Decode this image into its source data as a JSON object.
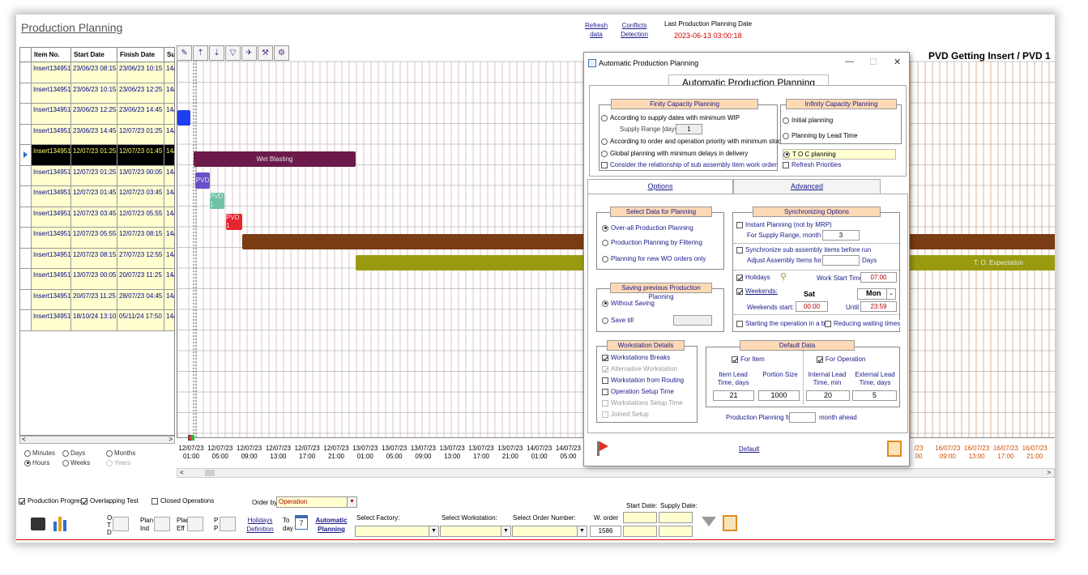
{
  "header": {
    "title": "Production Planning",
    "refresh_line1": "Refresh",
    "refresh_line2": "data",
    "conflicts_line1": "Conflicts",
    "conflicts_line2": "Detection",
    "last_planning_label": "Last Production Planning Date",
    "last_planning_value": "2023-06-13 03:00:18"
  },
  "grid": {
    "headers": [
      "Item No.",
      "Start Date",
      "Finish Date",
      "Su"
    ],
    "rows": [
      {
        "item": "Insert134951",
        "start": "23/06/23 08:15",
        "finish": "23/06/23 10:15",
        "su": "14/"
      },
      {
        "item": "Insert134951",
        "start": "23/06/23 10:15",
        "finish": "23/06/23 12:25",
        "su": "14/"
      },
      {
        "item": "Insert134951",
        "start": "23/06/23 12:25",
        "finish": "23/06/23 14:45",
        "su": "14/"
      },
      {
        "item": "Insert134951",
        "start": "23/06/23 14:45",
        "finish": "12/07/23 01:25",
        "su": "14/"
      },
      {
        "item": "Insert134951",
        "start": "12/07/23 01:25",
        "finish": "12/07/23 01:45",
        "su": "14/"
      },
      {
        "item": "Insert134951",
        "start": "12/07/23 01:25",
        "finish": "13/07/23 00:05",
        "su": "14/"
      },
      {
        "item": "Insert134951",
        "start": "12/07/23 01:45",
        "finish": "12/07/23 03:45",
        "su": "14/"
      },
      {
        "item": "Insert134951",
        "start": "12/07/23 03:45",
        "finish": "12/07/23 05:55",
        "su": "14/"
      },
      {
        "item": "Insert134951",
        "start": "12/07/23 05:55",
        "finish": "12/07/23 08:15",
        "su": "14/"
      },
      {
        "item": "Insert134951",
        "start": "12/07/23 08:15",
        "finish": "27/07/23 12:55",
        "su": "14/"
      },
      {
        "item": "Insert134951",
        "start": "13/07/23 00:05",
        "finish": "20/07/23 11:25",
        "su": "14/"
      },
      {
        "item": "Insert134951",
        "start": "20/07/23 11:25",
        "finish": "28/07/23 04:45",
        "su": "14/"
      },
      {
        "item": "Insert134951",
        "start": "18/10/24 13:10",
        "finish": "05/11/24 17:50",
        "su": "14/"
      }
    ],
    "selected_index": 4
  },
  "scale": {
    "minutes": "Minutes",
    "days": "Days",
    "months": "Months",
    "hours": "Hours",
    "weeks": "Weeks",
    "years": "Years"
  },
  "gantt": {
    "title": "PVD Getting Insert / PVD 1",
    "bars": [
      {
        "label": "Wet Blasting",
        "color": "#6b1a4a"
      },
      {
        "label": "PVD 1",
        "color": "#6a4fc8"
      },
      {
        "label": "PVD 1",
        "color": "#6fc2a4"
      },
      {
        "label": "PVD 1",
        "color": "#e8242f"
      },
      {
        "label": "",
        "color": "#7a3c12"
      },
      {
        "label": "T. O. Expectation",
        "color": "#9a9a10"
      }
    ],
    "timeline_left": [
      [
        "12/07/23",
        "01:00"
      ],
      [
        "12/07/23",
        "05:00"
      ],
      [
        "12/07/23",
        "09:00"
      ],
      [
        "12/07/23",
        "13:00"
      ],
      [
        "12/07/23",
        "17:00"
      ],
      [
        "12/07/23",
        "21:00"
      ],
      [
        "13/07/23",
        "01:00"
      ],
      [
        "13/07/23",
        "05:00"
      ],
      [
        "13/07/23",
        "09:00"
      ],
      [
        "13/07/23",
        "13:00"
      ],
      [
        "13/07/23",
        "17:00"
      ],
      [
        "13/07/23",
        "21:00"
      ],
      [
        "14/07/23",
        "01:00"
      ],
      [
        "14/07/23",
        "05:00"
      ]
    ],
    "timeline_right": [
      [
        "/23",
        "00"
      ],
      [
        "16/07/23",
        "09:00"
      ],
      [
        "16/07/23",
        "13:00"
      ],
      [
        "16/07/23",
        "17:00"
      ],
      [
        "16/07/23",
        "21:00"
      ],
      [
        "17/0",
        "01"
      ]
    ]
  },
  "bottom": {
    "production_progress": "Production Progress",
    "overlapping_test": "Overlapping Test",
    "closed_operations": "Closed Operations",
    "order_by_label": "Order by",
    "order_by_value": "Operation",
    "otd": [
      "O",
      "T",
      "D"
    ],
    "plan_ind": [
      "Plan",
      "Ind"
    ],
    "plan_eff": [
      "Plan",
      "Eff"
    ],
    "pp": [
      "P",
      "P"
    ],
    "holidays_def_1": "Holidays",
    "holidays_def_2": "Definition",
    "today_1": "To",
    "today_2": "day",
    "today_num": "7",
    "auto_plan_1": "Automatic",
    "auto_plan_2": "Planning",
    "select_factory": "Select Factory:",
    "select_workstation": "Select Workstation:",
    "select_order": "Select Order Number:",
    "w_order_label": "W. order",
    "w_order_value": "1586",
    "start_date": "Start Date:",
    "supply_date": "Supply Date:"
  },
  "dialog": {
    "window_title": "Automatic Production Planning",
    "header": "Automatic Production Planning",
    "finity": {
      "title": "Finity Capacity Planning",
      "opt1": "According to supply dates with minimum WIP",
      "supply_range_label": "Supply Range [days]",
      "supply_range_value": "1",
      "opt2": "According to order and operation priority with minimum stock",
      "opt3": "Global planning with minimum delays in delivery",
      "opt4": "Consider the relationship of sub assembly item work order"
    },
    "infinity": {
      "title": "Infinity Capacity Planning",
      "opt1": "Initial planning",
      "opt2": "Planning by Lead Time",
      "opt3": "T O C planning",
      "opt4": "Refresh Priorities"
    },
    "tabs": {
      "options": "Options",
      "advanced": "Advanced"
    },
    "select_data": {
      "title": "Select Data for Planning",
      "opt1": "Over-all Production Planning",
      "opt2": "Production Planning by Filtering",
      "opt3": "Planning for new WO orders only"
    },
    "saving": {
      "title": "Saving previous Production Planning",
      "opt1": "Without Saving",
      "opt2": "Save till"
    },
    "sync": {
      "title": "Synchronizing Options",
      "instant": "Instant Planning (not by MRP)",
      "for_supply": "For Supply Range, month",
      "for_supply_value": "3",
      "sync_sub": "Synchronize sub assembly items before run",
      "adjust": "Adjust Assembly Items for",
      "days": "Days",
      "holidays": "Holidays",
      "work_start_label": "Work Start Time",
      "work_start_value": "07:00",
      "weekends": "Weekends:",
      "sat": "Sat",
      "mon": "Mon",
      "weekends_start_label": "Weekends start:",
      "weekends_start_value": "00:00",
      "until_label": "Until",
      "until_value": "23:59",
      "starting_op": "Starting the operation in a bre",
      "reducing": "Reducing waiting times"
    },
    "workstation": {
      "title": "Workstation Details",
      "breaks": "Workstations Breaks",
      "alt": "Alternative Workstation",
      "from_routing": "Workstation from Routing",
      "setup": "Operation Setup Time",
      "ws_setup": "Workstations Setup Time",
      "joined": "Joined Setup"
    },
    "default_data": {
      "title": "Default Data",
      "for_item": "For Item",
      "for_operation": "For Operation",
      "item_lead_1": "Item Lead",
      "item_lead_2": "Time, days",
      "portion_1": "Portion Size",
      "internal_1": "Internal Lead",
      "internal_2": "Time, min",
      "external_1": "External Lead",
      "external_2": "Time, days",
      "item_lead_value": "21",
      "portion_value": "1000",
      "internal_value": "20",
      "external_value": "5",
      "planning_for": "Production Planning for",
      "month_ahead": "month ahead"
    },
    "default_link": "Default"
  }
}
